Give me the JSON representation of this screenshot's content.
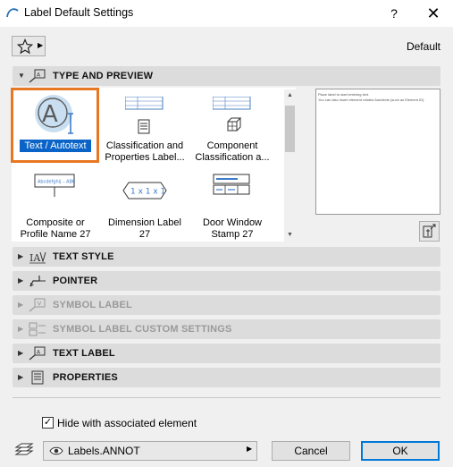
{
  "window": {
    "title": "Label Default Settings",
    "help_label": "?",
    "close_label": "✕"
  },
  "favorites": {
    "default_label": "Default"
  },
  "panels": {
    "type_and_preview": "TYPE AND PREVIEW",
    "text_style": "TEXT STYLE",
    "pointer": "POINTER",
    "symbol_label": "SYMBOL LABEL",
    "symbol_label_custom": "SYMBOL LABEL CUSTOM SETTINGS",
    "text_label": "TEXT LABEL",
    "properties": "PROPERTIES"
  },
  "tiles": [
    {
      "line1": "Text / Autotext",
      "line2": ""
    },
    {
      "line1": "Classification and",
      "line2": "Properties Label..."
    },
    {
      "line1": "Component",
      "line2": "Classification a..."
    },
    {
      "line1": "Composite or",
      "line2": "Profile Name 27"
    },
    {
      "line1": "Dimension Label",
      "line2": "27"
    },
    {
      "line1": "Door Window",
      "line2": "Stamp 27"
    }
  ],
  "tile_icons": {
    "composite_text": "Abcdefghij – ABC",
    "dimension_text": "1 x 1 x 1"
  },
  "preview": {
    "line1": "Place label to start entering text.",
    "line2": "You can also insert element related Autotexts (such as Element ID)."
  },
  "options": {
    "hide_with_element_label": "Hide with associated element",
    "hide_with_element_checked": true
  },
  "footer": {
    "layer_value": "Labels.ANNOT",
    "cancel_label": "Cancel",
    "ok_label": "OK"
  },
  "colors": {
    "selection_outline": "#e87722",
    "selection_bg": "#0a64c8",
    "ok_border": "#0078d7"
  }
}
